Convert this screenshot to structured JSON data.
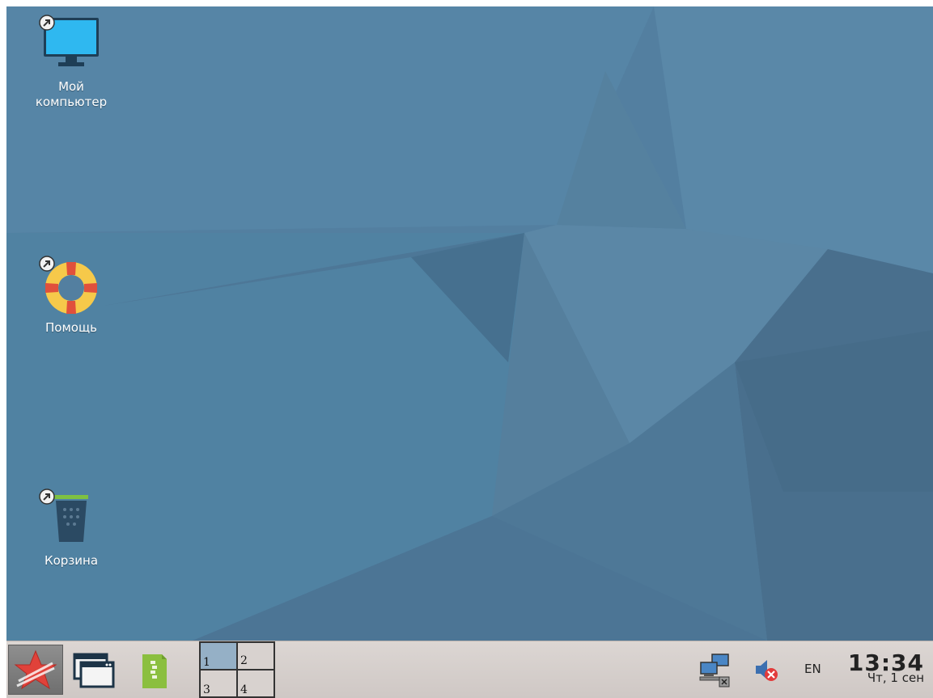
{
  "desktop": {
    "wallpaper_color": "#4f7c9c",
    "icons": [
      {
        "label_line1": "Мой",
        "label_line2": "компьютер",
        "icon": "monitor-icon"
      },
      {
        "label": "Помощь",
        "icon": "lifebuoy-icon"
      },
      {
        "label": "Корзина",
        "icon": "trash-icon"
      }
    ]
  },
  "taskbar": {
    "start_icon": "star-icon",
    "show_windows_icon": "windows-icon",
    "files_icon": "file-manager-icon",
    "pager": {
      "desktops": [
        "1",
        "2",
        "3",
        "4"
      ],
      "active": "1"
    },
    "tray": {
      "network_icon": "network-icon",
      "volume_icon": "volume-muted-icon",
      "language": "EN"
    },
    "clock": {
      "time": "13:34",
      "date": "Чт, 1 сен"
    }
  }
}
